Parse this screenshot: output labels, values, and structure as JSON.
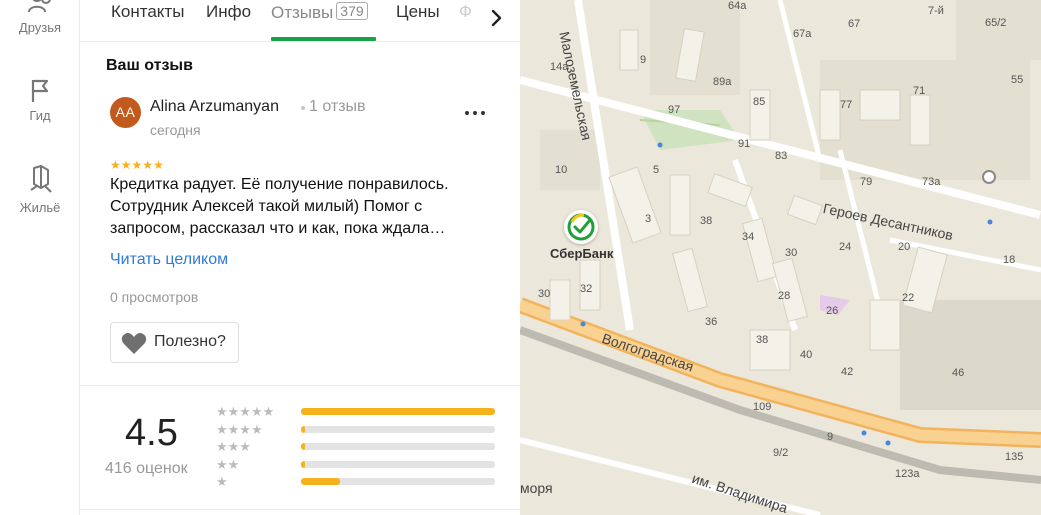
{
  "nav": {
    "items": [
      {
        "label": "Друзья",
        "icon": "friends-icon"
      },
      {
        "label": "Гид",
        "icon": "flag-icon"
      },
      {
        "label": "Жильё",
        "icon": "house-icon"
      }
    ]
  },
  "tabs": {
    "items": [
      {
        "label": "Контакты"
      },
      {
        "label": "Инфо"
      },
      {
        "label": "Отзывы",
        "count": "379",
        "active": true
      },
      {
        "label": "Цены"
      },
      {
        "label": "Ф"
      }
    ],
    "next_icon": "chevron-right-icon"
  },
  "review": {
    "section_title": "Ваш отзыв",
    "author_initials": "AA",
    "author_name": "Alina Arzumanyan",
    "author_review_count": "1 отзыв",
    "date": "сегодня",
    "rating": 5,
    "text": "Кредитка радует. Её получение понравилось. Сотрудник Алексей такой милый) Помог с запросом, рассказал что и как, пока ждала…",
    "read_more": "Читать целиком",
    "views": "0 просмотров",
    "useful_label": "Полезно?",
    "more_icon": "more-dots-icon",
    "avatar_color": "#c2591d"
  },
  "summary": {
    "rating": "4.5",
    "ratings_count": "416 оценок",
    "histogram": [
      {
        "stars": 5,
        "fraction": 1.0
      },
      {
        "stars": 4,
        "fraction": 0.02
      },
      {
        "stars": 3,
        "fraction": 0.02
      },
      {
        "stars": 2,
        "fraction": 0.02
      },
      {
        "stars": 1,
        "fraction": 0.2
      }
    ]
  },
  "map": {
    "poi_name": "СберБанк",
    "streets": [
      "Малоземельская",
      "Героев Десантников",
      "Волгоградская",
      "им. Владимира",
      "моря"
    ],
    "house_numbers": [
      "64a",
      "67",
      "67a",
      "7-й",
      "65/2",
      "14a",
      "9",
      "89a",
      "55",
      "97",
      "85",
      "77",
      "71",
      "91",
      "83",
      "79",
      "73a",
      "10",
      "5",
      "3",
      "38",
      "34",
      "30",
      "24",
      "20",
      "18",
      "22",
      "30",
      "32",
      "28",
      "26",
      "36",
      "38",
      "40",
      "42",
      "46",
      "109",
      "9",
      "9/2",
      "123a",
      "135"
    ],
    "accent_color": "#f2b35c"
  },
  "colors": {
    "accent_green": "#1aa048",
    "link_blue": "#2f7bd6",
    "star_yellow": "#f5b21c"
  }
}
